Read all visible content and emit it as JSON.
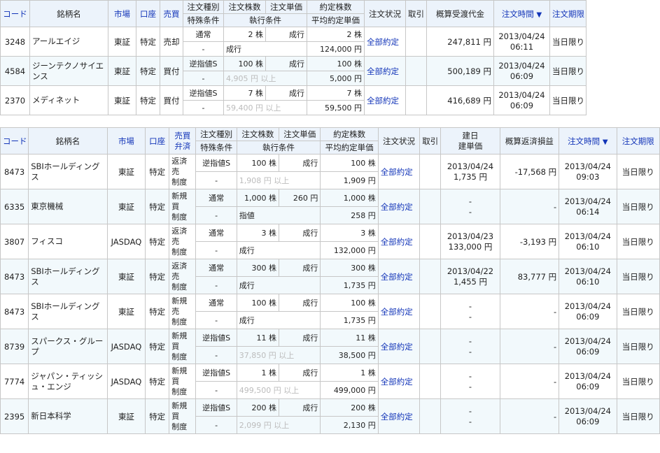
{
  "headers1": {
    "code": "コード",
    "name": "銘柄名",
    "market": "市場",
    "account": "口座",
    "trade": "売買",
    "order_type": "注文種別",
    "special": "特殊条件",
    "qty": "注文株数",
    "price": "注文単価",
    "exec_cond": "執行条件",
    "filled_qty": "約定株数",
    "avg_price": "平均約定単価",
    "status": "注文状況",
    "torihiki": "取引",
    "amount": "概算受渡代金",
    "order_time": "注文時間",
    "sort_arrow": "▼",
    "expiry": "注文期限"
  },
  "orders1": [
    {
      "code": "3248",
      "name": "アールエイジ",
      "market": "東証",
      "account": "特定",
      "trade": "売却",
      "order_type": "通常",
      "qty": "2 株",
      "price": "成行",
      "filled_qty": "2 株",
      "special": "-",
      "exec_cond": "成行",
      "avg_price": "124,000 円",
      "status": "全部約定",
      "torihiki": "",
      "amount": "247,811 円",
      "date": "2013/04/24",
      "time": "06:11",
      "expiry": "当日限り"
    },
    {
      "code": "4584",
      "name": "ジーンテクノサイエンス",
      "market": "東証",
      "account": "特定",
      "trade": "買付",
      "order_type": "逆指値S",
      "qty": "100 株",
      "price": "成行",
      "filled_qty": "100 株",
      "special": "-",
      "exec_cond": "4,905 円 以上",
      "avg_price": "5,000 円",
      "status": "全部約定",
      "torihiki": "",
      "amount": "500,189 円",
      "date": "2013/04/24",
      "time": "06:09",
      "expiry": "当日限り"
    },
    {
      "code": "2370",
      "name": "メディネット",
      "market": "東証",
      "account": "特定",
      "trade": "買付",
      "order_type": "逆指値S",
      "qty": "7 株",
      "price": "成行",
      "filled_qty": "7 株",
      "special": "-",
      "exec_cond": "59,400 円 以上",
      "avg_price": "59,500 円",
      "status": "全部約定",
      "torihiki": "",
      "amount": "416,689 円",
      "date": "2013/04/24",
      "time": "06:09",
      "expiry": "当日限り"
    }
  ],
  "headers2": {
    "code": "コード",
    "name": "銘柄名",
    "market": "市場",
    "account": "口座",
    "trade_top": "売買",
    "trade_bottom": "弁済",
    "order_type": "注文種別",
    "special": "特殊条件",
    "qty": "注文株数",
    "price": "注文単価",
    "exec_cond": "執行条件",
    "filled_qty": "約定株数",
    "avg_price": "平均約定単価",
    "status": "注文状況",
    "torihiki": "取引",
    "build_top": "建日",
    "build_bottom": "建単価",
    "pnl": "概算返済損益",
    "order_time": "注文時間",
    "sort_arrow": "▼",
    "expiry": "注文期限"
  },
  "orders2": [
    {
      "code": "8473",
      "name": "SBIホールディングス",
      "market": "東証",
      "account": "特定",
      "trade": [
        "返済",
        "売",
        "制度"
      ],
      "order_type": "逆指値S",
      "qty": "100 株",
      "price": "成行",
      "filled_qty": "100 株",
      "special": "-",
      "exec_cond": "1,908 円 以上",
      "avg_price": "1,909 円",
      "status": "全部約定",
      "torihiki": "",
      "build_date": "2013/04/24",
      "build_price": "1,735 円",
      "pnl": "-17,568 円",
      "date": "2013/04/24",
      "time": "09:03",
      "expiry": "当日限り"
    },
    {
      "code": "6335",
      "name": "東京機械",
      "market": "東証",
      "account": "特定",
      "trade": [
        "新規",
        "買",
        "制度"
      ],
      "order_type": "通常",
      "qty": "1,000 株",
      "price": "260 円",
      "filled_qty": "1,000 株",
      "special": "-",
      "exec_cond": "指値",
      "avg_price": "258 円",
      "status": "全部約定",
      "torihiki": "",
      "build_date": "-",
      "build_price": "-",
      "pnl": "-",
      "date": "2013/04/24",
      "time": "06:14",
      "expiry": "当日限り"
    },
    {
      "code": "3807",
      "name": "フィスコ",
      "market": "JASDAQ",
      "account": "特定",
      "trade": [
        "返済",
        "売",
        "制度"
      ],
      "order_type": "通常",
      "qty": "3 株",
      "price": "成行",
      "filled_qty": "3 株",
      "special": "-",
      "exec_cond": "成行",
      "avg_price": "132,000 円",
      "status": "全部約定",
      "torihiki": "",
      "build_date": "2013/04/23",
      "build_price": "133,000 円",
      "pnl": "-3,193 円",
      "date": "2013/04/24",
      "time": "06:10",
      "expiry": "当日限り"
    },
    {
      "code": "8473",
      "name": "SBIホールディングス",
      "market": "東証",
      "account": "特定",
      "trade": [
        "返済",
        "売",
        "制度"
      ],
      "order_type": "通常",
      "qty": "300 株",
      "price": "成行",
      "filled_qty": "300 株",
      "special": "-",
      "exec_cond": "成行",
      "avg_price": "1,735 円",
      "status": "全部約定",
      "torihiki": "",
      "build_date": "2013/04/22",
      "build_price": "1,455 円",
      "pnl": "83,777 円",
      "date": "2013/04/24",
      "time": "06:10",
      "expiry": "当日限り"
    },
    {
      "code": "8473",
      "name": "SBIホールディングス",
      "market": "東証",
      "account": "特定",
      "trade": [
        "新規",
        "売",
        "制度"
      ],
      "order_type": "通常",
      "qty": "100 株",
      "price": "成行",
      "filled_qty": "100 株",
      "special": "-",
      "exec_cond": "成行",
      "avg_price": "1,735 円",
      "status": "全部約定",
      "torihiki": "",
      "build_date": "-",
      "build_price": "-",
      "pnl": "-",
      "date": "2013/04/24",
      "time": "06:09",
      "expiry": "当日限り"
    },
    {
      "code": "8739",
      "name": "スパークス・グループ",
      "market": "JASDAQ",
      "account": "特定",
      "trade": [
        "新規",
        "買",
        "制度"
      ],
      "order_type": "逆指値S",
      "qty": "11 株",
      "price": "成行",
      "filled_qty": "11 株",
      "special": "-",
      "exec_cond": "37,850 円 以上",
      "avg_price": "38,500 円",
      "status": "全部約定",
      "torihiki": "",
      "build_date": "-",
      "build_price": "-",
      "pnl": "-",
      "date": "2013/04/24",
      "time": "06:09",
      "expiry": "当日限り"
    },
    {
      "code": "7774",
      "name": "ジャパン・ティッシュ・エンジ",
      "market": "JASDAQ",
      "account": "特定",
      "trade": [
        "新規",
        "買",
        "制度"
      ],
      "order_type": "逆指値S",
      "qty": "1 株",
      "price": "成行",
      "filled_qty": "1 株",
      "special": "-",
      "exec_cond": "499,500 円 以上",
      "avg_price": "499,000 円",
      "status": "全部約定",
      "torihiki": "",
      "build_date": "-",
      "build_price": "-",
      "pnl": "-",
      "date": "2013/04/24",
      "time": "06:09",
      "expiry": "当日限り"
    },
    {
      "code": "2395",
      "name": "新日本科学",
      "market": "東証",
      "account": "特定",
      "trade": [
        "新規",
        "買",
        "制度"
      ],
      "order_type": "逆指値S",
      "qty": "200 株",
      "price": "成行",
      "filled_qty": "200 株",
      "special": "-",
      "exec_cond": "2,099 円 以上",
      "avg_price": "2,130 円",
      "status": "全部約定",
      "torihiki": "",
      "build_date": "-",
      "build_price": "-",
      "pnl": "-",
      "date": "2013/04/24",
      "time": "06:09",
      "expiry": "当日限り"
    }
  ]
}
